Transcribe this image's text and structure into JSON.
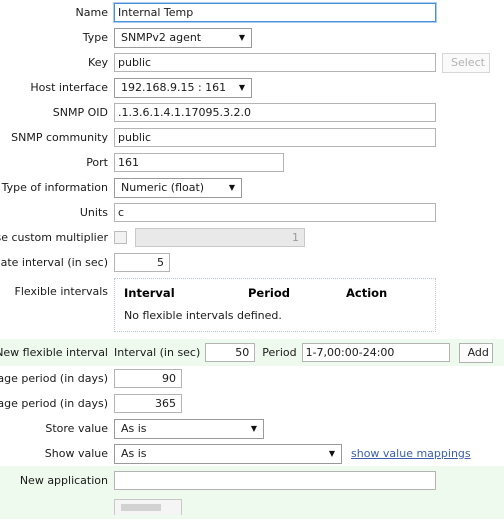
{
  "form": {
    "rows": [
      {
        "label": "Name",
        "value": "Internal Temp"
      },
      {
        "label": "Type",
        "value": "SNMPv2 agent"
      },
      {
        "label": "Key",
        "value": "public",
        "button": "Select"
      },
      {
        "label": "Host interface",
        "value": "192.168.9.15 : 161"
      },
      {
        "label": "SNMP OID",
        "value": ".1.3.6.1.4.1.17095.3.2.0"
      },
      {
        "label": "SNMP community",
        "value": "public"
      },
      {
        "label": "Port",
        "value": "161"
      },
      {
        "label": "Type of information",
        "value": "Numeric (float)"
      },
      {
        "label": "Units",
        "value": "c"
      },
      {
        "label": "Use custom multiplier",
        "value": "1"
      },
      {
        "label": "Update interval (in sec)",
        "value": "5"
      },
      {
        "label": "Flexible intervals"
      },
      {
        "label": "New flexible interval"
      },
      {
        "label": "History storage period (in days)",
        "value": "90"
      },
      {
        "label": "Trend storage period (in days)",
        "value": "365"
      },
      {
        "label": "Store value",
        "value": "As is"
      },
      {
        "label": "Show value",
        "value": "As is"
      },
      {
        "label": "New application",
        "value": ""
      }
    ],
    "name": {
      "label": "Name",
      "value": "Internal Temp"
    },
    "type": {
      "label": "Type",
      "value": "SNMPv2 agent"
    },
    "key": {
      "label": "Key",
      "value": "public",
      "select_button": "Select"
    },
    "host_interface": {
      "label": "Host interface",
      "value": "192.168.9.15 : 161"
    },
    "snmp_oid": {
      "label": "SNMP OID",
      "value": ".1.3.6.1.4.1.17095.3.2.0"
    },
    "snmp_community": {
      "label": "SNMP community",
      "value": "public"
    },
    "port": {
      "label": "Port",
      "value": "161"
    },
    "type_of_information": {
      "label": "Type of information",
      "value": "Numeric (float)"
    },
    "units": {
      "label": "Units",
      "value": "c"
    },
    "custom_multiplier": {
      "label": "Use custom multiplier",
      "value": "1",
      "checked": false
    },
    "update_interval": {
      "label": "Update interval (in sec)",
      "value": "5"
    },
    "flexible_intervals": {
      "label": "Flexible intervals",
      "columns": {
        "interval": "Interval",
        "period": "Period",
        "action": "Action"
      },
      "empty_text": "No flexible intervals defined."
    },
    "new_flexible_interval": {
      "label": "New flexible interval",
      "interval_label": "Interval (in sec)",
      "interval_value": "50",
      "period_label": "Period",
      "period_value": "1-7,00:00-24:00",
      "add_button": "Add"
    },
    "history_period": {
      "label": "History storage period (in days)",
      "value": "90"
    },
    "trend_period": {
      "label": "Trend storage period (in days)",
      "value": "365"
    },
    "store_value": {
      "label": "Store value",
      "value": "As is"
    },
    "show_value": {
      "label": "Show value",
      "value": "As is",
      "link": "show value mappings"
    },
    "new_application": {
      "label": "New application",
      "value": "",
      "placeholder": ""
    }
  },
  "icons": {
    "dropdown_arrow": "▼"
  },
  "colors": {
    "highlight_row_bg": "#eefaee",
    "focus_border": "#4a90d9",
    "link": "#3a5fa8",
    "field_border": "#b4b4b4"
  }
}
